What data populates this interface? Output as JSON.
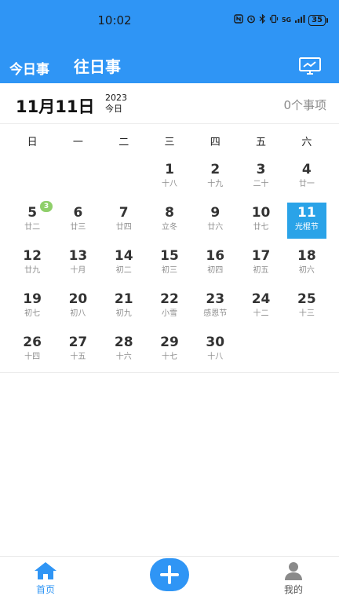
{
  "status_bar": {
    "time": "10:02",
    "icons": [
      "nfc-icon",
      "alarm-icon",
      "bluetooth-icon",
      "vibrate-icon",
      "signal-icon"
    ],
    "network": "5G",
    "battery": "35"
  },
  "header": {
    "tabs": [
      "今日事",
      "往日事"
    ],
    "screen_icon": "screen-cast-icon"
  },
  "date_bar": {
    "date": "11月11日",
    "year": "2023",
    "today": "今日",
    "event_count": "0个事项"
  },
  "calendar": {
    "weekdays": [
      "日",
      "一",
      "二",
      "三",
      "四",
      "五",
      "六"
    ],
    "days": [
      {
        "num": "",
        "lunar": ""
      },
      {
        "num": "",
        "lunar": ""
      },
      {
        "num": "",
        "lunar": ""
      },
      {
        "num": "1",
        "lunar": "十八"
      },
      {
        "num": "2",
        "lunar": "十九"
      },
      {
        "num": "3",
        "lunar": "二十"
      },
      {
        "num": "4",
        "lunar": "廿一"
      },
      {
        "num": "5",
        "lunar": "廿二",
        "badge": "3"
      },
      {
        "num": "6",
        "lunar": "廿三"
      },
      {
        "num": "7",
        "lunar": "廿四"
      },
      {
        "num": "8",
        "lunar": "立冬"
      },
      {
        "num": "9",
        "lunar": "廿六"
      },
      {
        "num": "10",
        "lunar": "廿七"
      },
      {
        "num": "11",
        "lunar": "光棍节",
        "selected": true
      },
      {
        "num": "12",
        "lunar": "廿九"
      },
      {
        "num": "13",
        "lunar": "十月"
      },
      {
        "num": "14",
        "lunar": "初二"
      },
      {
        "num": "15",
        "lunar": "初三"
      },
      {
        "num": "16",
        "lunar": "初四"
      },
      {
        "num": "17",
        "lunar": "初五"
      },
      {
        "num": "18",
        "lunar": "初六"
      },
      {
        "num": "19",
        "lunar": "初七"
      },
      {
        "num": "20",
        "lunar": "初八"
      },
      {
        "num": "21",
        "lunar": "初九"
      },
      {
        "num": "22",
        "lunar": "小雪"
      },
      {
        "num": "23",
        "lunar": "感恩节"
      },
      {
        "num": "24",
        "lunar": "十二"
      },
      {
        "num": "25",
        "lunar": "十三"
      },
      {
        "num": "26",
        "lunar": "十四"
      },
      {
        "num": "27",
        "lunar": "十五"
      },
      {
        "num": "28",
        "lunar": "十六"
      },
      {
        "num": "29",
        "lunar": "十七"
      },
      {
        "num": "30",
        "lunar": "十八"
      }
    ]
  },
  "bottom_nav": {
    "home": "首页",
    "add_icon": "plus-icon",
    "mine": "我的"
  },
  "colors": {
    "primary": "#2f95f5",
    "selected": "#2aa3e8",
    "badge": "#8fcf6a"
  }
}
